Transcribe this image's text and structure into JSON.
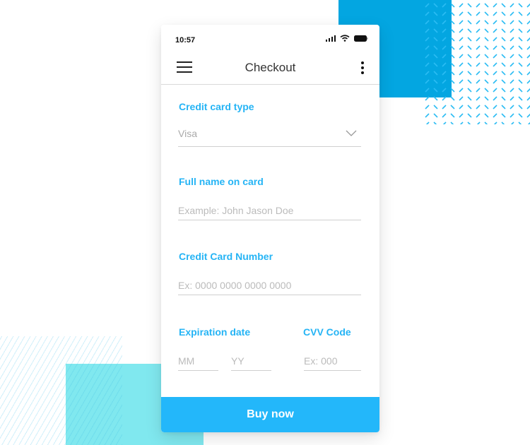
{
  "colors": {
    "accent": "#23b7fa",
    "label": "#25b4f5",
    "deco_blue": "#03a6e1",
    "deco_cyan": "#80e8ef"
  },
  "status_bar": {
    "time": "10:57",
    "icons": [
      "signal-icon",
      "wifi-icon",
      "battery-icon"
    ]
  },
  "header": {
    "title": "Checkout",
    "menu_icon": "hamburger-menu-icon",
    "more_icon": "more-vertical-icon"
  },
  "form": {
    "card_type": {
      "label": "Credit card type",
      "value": "Visa",
      "icon": "chevron-down-icon"
    },
    "full_name": {
      "label": "Full name on card",
      "placeholder": "Example: John Jason Doe"
    },
    "card_number": {
      "label": "Credit Card Number",
      "placeholder": "Ex: 0000 0000 0000 0000"
    },
    "expiration": {
      "label": "Expiration date",
      "month_placeholder": "MM",
      "year_placeholder": "YY"
    },
    "cvv": {
      "label": "CVV Code",
      "placeholder": "Ex: 000"
    }
  },
  "actions": {
    "buy_label": "Buy now"
  }
}
